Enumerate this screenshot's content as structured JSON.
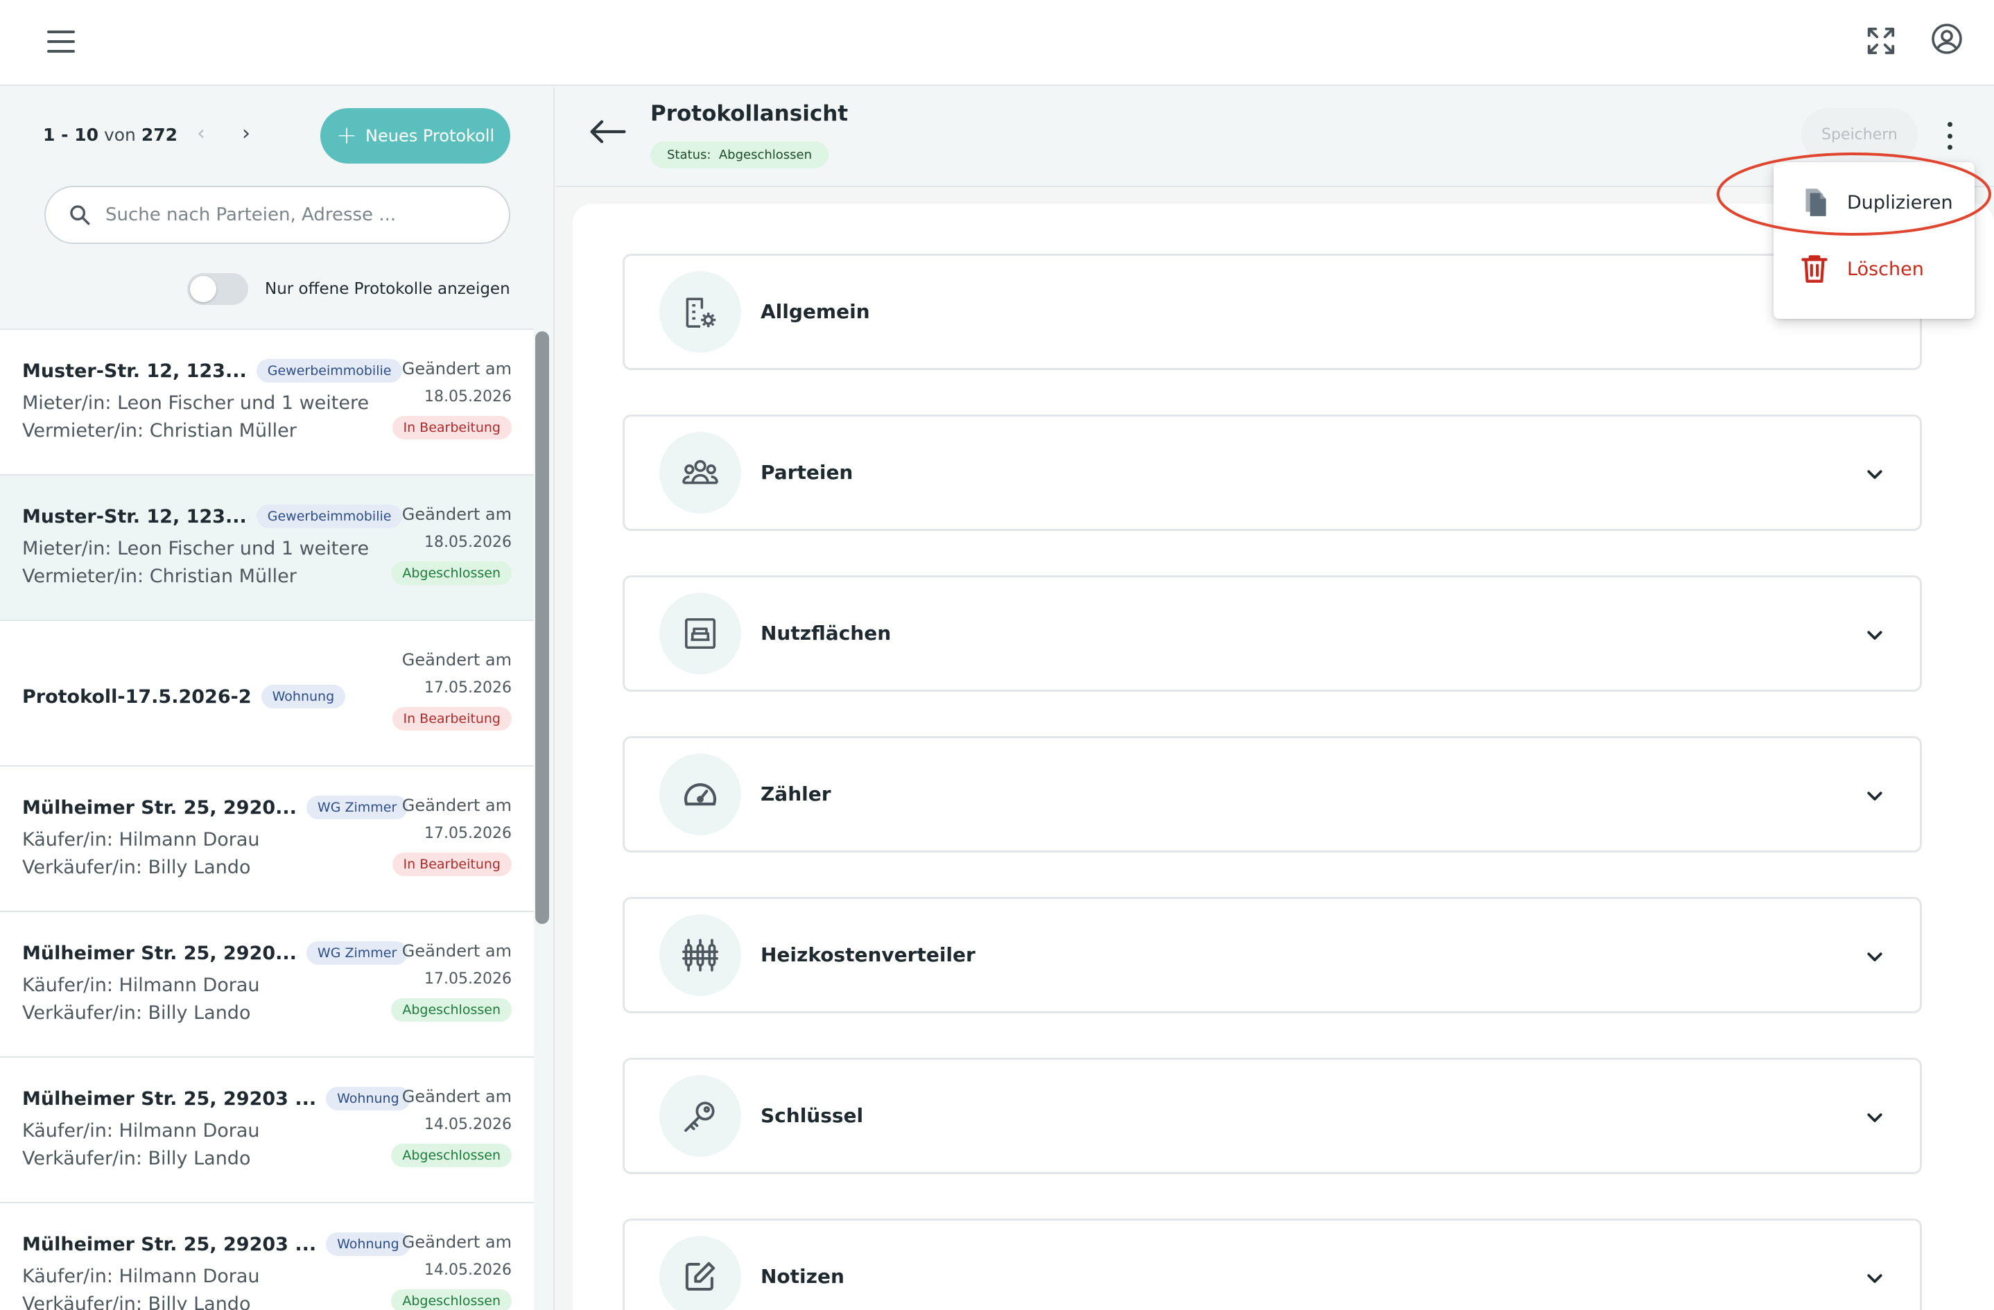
{
  "pager": {
    "from": "1",
    "sep": " - ",
    "to": "10",
    "of_label": " von ",
    "total": "272"
  },
  "new_button_label": "Neues Protokoll",
  "search": {
    "placeholder": "Suche nach Parteien, Adresse ..."
  },
  "toggle_label": "Nur offene Protokolle anzeigen",
  "list": [
    {
      "title": "Muster-Str. 12, 123...",
      "tag": "Gewerbeimmobilie",
      "line1": "Mieter/in: Leon Fischer und 1 weitere",
      "line2": "Vermieter/in: Christian Müller",
      "changed": "Geändert am",
      "date": "18.05.2026",
      "status": "In Bearbeitung"
    },
    {
      "title": "Muster-Str. 12, 123...",
      "tag": "Gewerbeimmobilie",
      "line1": "Mieter/in: Leon Fischer und 1 weitere",
      "line2": "Vermieter/in: Christian Müller",
      "changed": "Geändert am",
      "date": "18.05.2026",
      "status": "Abgeschlossen"
    },
    {
      "title": "Protokoll-17.5.2026-2",
      "tag": "Wohnung",
      "line1": "",
      "line2": "",
      "changed": "Geändert am",
      "date": "17.05.2026",
      "status": "In Bearbeitung"
    },
    {
      "title": "Mülheimer Str. 25, 2920...",
      "tag": "WG Zimmer",
      "line1": "Käufer/in: Hilmann Dorau",
      "line2": "Verkäufer/in: Billy Lando",
      "changed": "Geändert am",
      "date": "17.05.2026",
      "status": "In Bearbeitung"
    },
    {
      "title": "Mülheimer Str. 25, 2920...",
      "tag": "WG Zimmer",
      "line1": "Käufer/in: Hilmann Dorau",
      "line2": "Verkäufer/in: Billy Lando",
      "changed": "Geändert am",
      "date": "17.05.2026",
      "status": "Abgeschlossen"
    },
    {
      "title": "Mülheimer Str. 25, 29203 ...",
      "tag": "Wohnung",
      "line1": "Käufer/in: Hilmann Dorau",
      "line2": "Verkäufer/in: Billy Lando",
      "changed": "Geändert am",
      "date": "14.05.2026",
      "status": "Abgeschlossen"
    },
    {
      "title": "Mülheimer Str. 25, 29203 ...",
      "tag": "Wohnung",
      "line1": "Käufer/in: Hilmann Dorau",
      "line2": "Verkäufer/in: Billy Lando",
      "changed": "Geändert am",
      "date": "14.05.2026",
      "status": "Abgeschlossen"
    }
  ],
  "header": {
    "title": "Protokollansicht",
    "status": "Status:  Abgeschlossen",
    "save_label": "Speichern"
  },
  "sections": [
    {
      "label": "Allgemein",
      "icon": "building-settings-icon"
    },
    {
      "label": "Parteien",
      "icon": "people-icon"
    },
    {
      "label": "Nutzflächen",
      "icon": "room-icon"
    },
    {
      "label": "Zähler",
      "icon": "gauge-icon"
    },
    {
      "label": "Heizkostenverteiler",
      "icon": "heat-meter-icon"
    },
    {
      "label": "Schlüssel",
      "icon": "key-icon"
    },
    {
      "label": "Notizen",
      "icon": "edit-icon"
    }
  ],
  "menu": {
    "duplicate_label": "Duplizieren",
    "delete_label": "Löschen"
  },
  "colors": {
    "accent": "#5bbfbd",
    "danger": "#c9291c",
    "highlight_ring": "#e0452f",
    "status_green_bg": "#def5e4",
    "status_red_bg": "#fbe3e3",
    "tag_bg": "#e4ebf6"
  }
}
